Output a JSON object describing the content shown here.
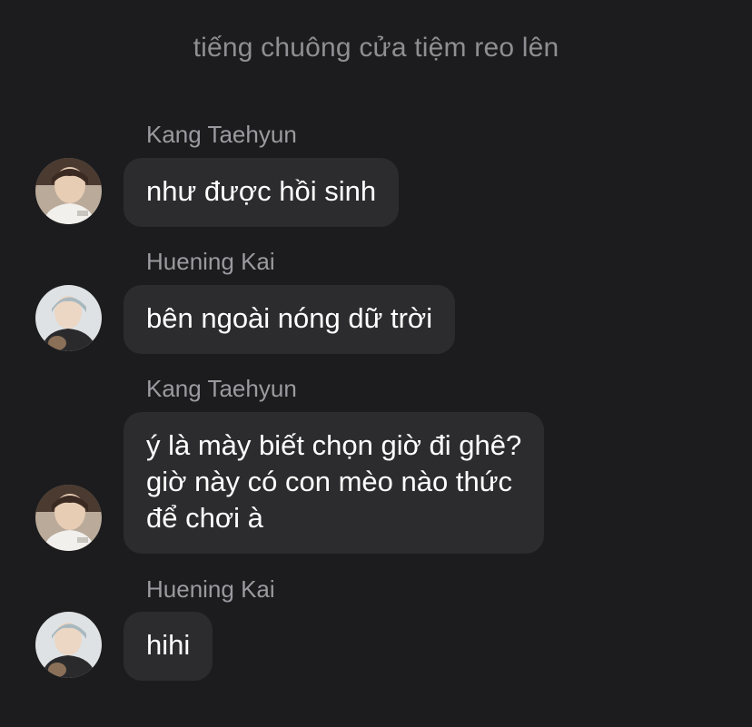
{
  "system_message": "tiếng chuông cửa tiệm reo lên",
  "messages": [
    {
      "sender": "Kang Taehyun",
      "text": "như được hồi sinh",
      "avatar": "avatar-kang-taehyun"
    },
    {
      "sender": "Huening Kai",
      "text": "bên ngoài nóng dữ trời",
      "avatar": "avatar-huening-kai"
    },
    {
      "sender": "Kang Taehyun",
      "text": "ý là mày biết chọn giờ đi ghê?\ngiờ này có con mèo nào thức\nđể chơi à",
      "avatar": "avatar-kang-taehyun"
    },
    {
      "sender": "Huening Kai",
      "text": "hihi",
      "avatar": "avatar-huening-kai"
    }
  ],
  "colors": {
    "background": "#1c1c1e",
    "bubble": "#2c2c2e",
    "sender_text": "#9a9aa0",
    "system_text": "#8e8e93",
    "message_text": "#ffffff"
  }
}
